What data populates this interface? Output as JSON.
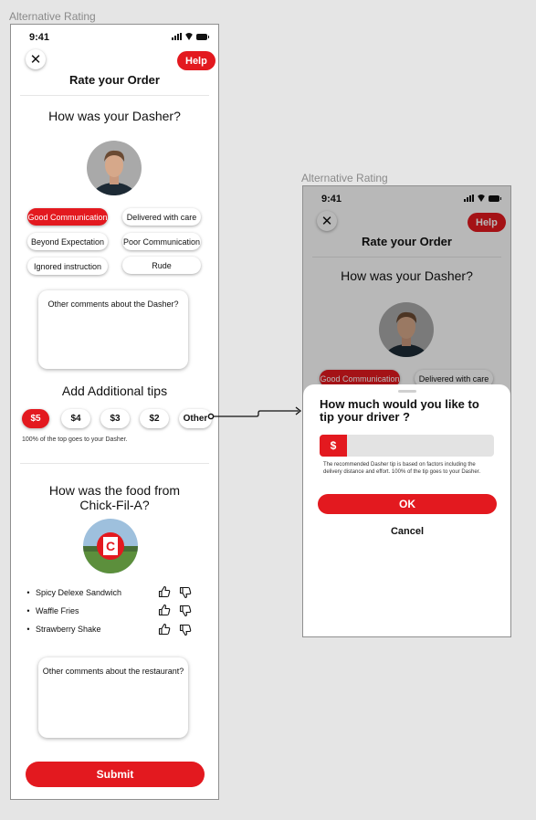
{
  "frames": [
    {
      "label": "Alternative Rating"
    },
    {
      "label": "Alternative Rating"
    }
  ],
  "status": {
    "time": "9:41"
  },
  "header": {
    "close_glyph": "✕",
    "help_label": "Help",
    "title": "Rate your Order"
  },
  "dasher": {
    "question": "How was your Dasher?",
    "chips": [
      {
        "label": "Good Communication",
        "active": true
      },
      {
        "label": "Delivered with care",
        "active": false
      },
      {
        "label": "Beyond Expectation",
        "active": false
      },
      {
        "label": "Poor Communication",
        "active": false
      },
      {
        "label": "Ignored instruction",
        "active": false
      },
      {
        "label": "Rude",
        "active": false
      }
    ],
    "comment_placeholder": "Other comments about the Dasher?"
  },
  "tips": {
    "title": "Add Additional tips",
    "options": [
      {
        "label": "$5",
        "active": true
      },
      {
        "label": "$4",
        "active": false
      },
      {
        "label": "$3",
        "active": false
      },
      {
        "label": "$2",
        "active": false
      },
      {
        "label": "Other",
        "active": false
      }
    ],
    "note": "100% of the top goes to your Dasher."
  },
  "food": {
    "question": "How was the food from Chick-Fil-A?",
    "items": [
      {
        "bullet": "•",
        "name": "Spicy Delexe Sandwich"
      },
      {
        "bullet": "•",
        "name": "Waffle Fries"
      },
      {
        "bullet": "•",
        "name": "Strawberry Shake"
      }
    ],
    "comment_placeholder": "Other comments about the restaurant?"
  },
  "submit_label": "Submit",
  "tip_sheet": {
    "title": "How much would you like to tip your driver ?",
    "currency": "$",
    "note": "The recommended Dasher tip is based on factors including the delivery distance and effort. 100% of the tip goes to your Dasher.",
    "ok_label": "OK",
    "cancel_label": "Cancel"
  },
  "colors": {
    "accent": "#e3191f"
  }
}
